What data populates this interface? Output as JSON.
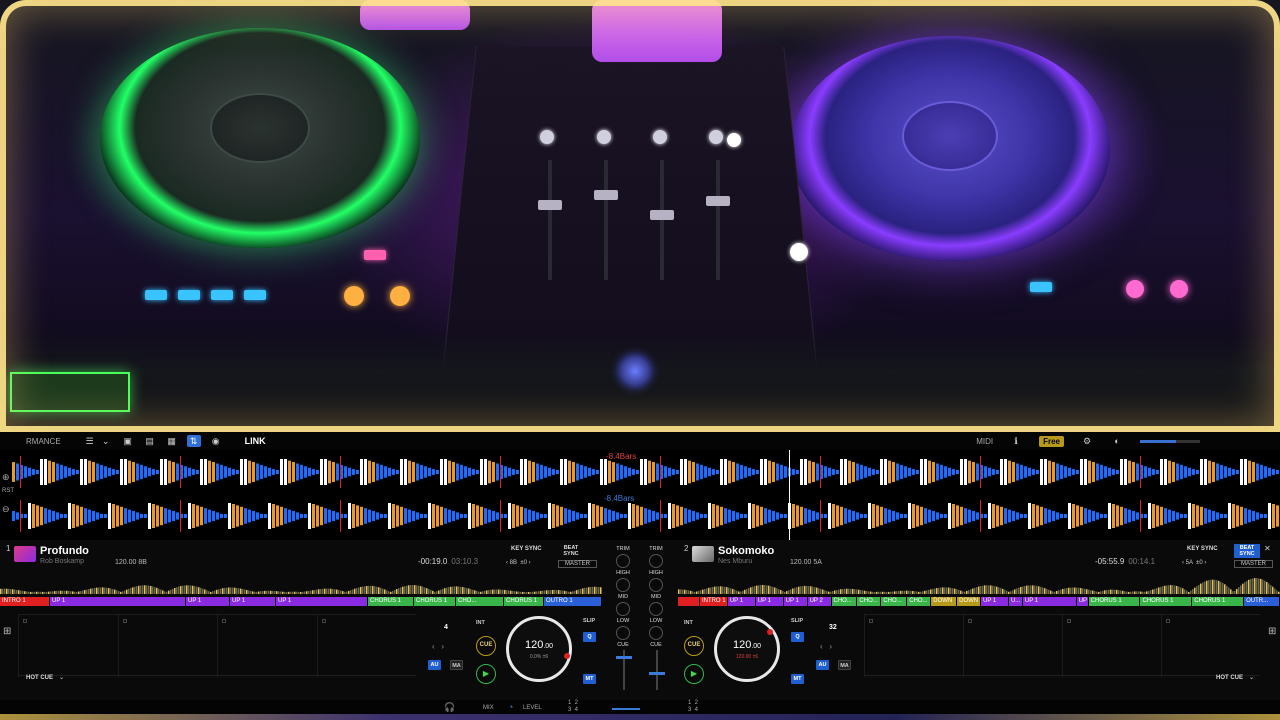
{
  "toolbar": {
    "mode_label": "RMANCE",
    "link_label": "LINK",
    "midi_label": "MIDI",
    "free_label": "Free",
    "icons": [
      "list-icon",
      "chevron-down-icon",
      "image-icon",
      "pin-icon",
      "grid-icon",
      "mixer-icon",
      "record-icon",
      "info-icon",
      "settings-icon",
      "volume-icon"
    ]
  },
  "waveforms": {
    "top_lag": "-8.4Bars",
    "bottom_lag": "-8.4Bars",
    "zoom_in_icon": "zoom-in-icon",
    "zoom_out_icon": "zoom-out-icon",
    "reset_label": "RST"
  },
  "deck_a": {
    "number": "1",
    "title": "Profundo",
    "artist": "Rob Boskamp",
    "bpm_key": "120.00 8B",
    "time_remaining": "-00:19.0",
    "time_total": "03:10.3",
    "key_sync_label": "KEY SYNC",
    "key_value": "8B",
    "key_offset": "±0",
    "beat_sync_label": "BEAT SYNC",
    "master_label": "MASTER",
    "structure": [
      {
        "label": "INTRO 1",
        "color": "#e02020",
        "w": 50
      },
      {
        "label": "UP 1",
        "color": "#8a2be2",
        "w": 136
      },
      {
        "label": "UP 1",
        "color": "#8a2be2",
        "w": 44
      },
      {
        "label": "UP 1",
        "color": "#8a2be2",
        "w": 46
      },
      {
        "label": "UP 1",
        "color": "#8a2be2",
        "w": 92
      },
      {
        "label": "CHORUS 1",
        "color": "#39b54a",
        "w": 46
      },
      {
        "label": "CHORUS 1",
        "color": "#39b54a",
        "w": 42
      },
      {
        "label": "CHO...",
        "color": "#39b54a",
        "w": 48
      },
      {
        "label": "CHORUS 1",
        "color": "#39b54a",
        "w": 40
      },
      {
        "label": "OUTRO 1",
        "color": "#2a5fd8",
        "w": 58
      }
    ],
    "beat_count": "4",
    "quantize_label": "INT",
    "cue_label": "CUE",
    "play_icon": "play-icon",
    "bpm": "120",
    "bpm_dec": ".00",
    "pitch": "0.0%  ±6",
    "slip_label": "SLIP",
    "q_label": "Q",
    "au_label": "AU",
    "ma_label": "MA",
    "mt_label": "MT",
    "hotcue_label": "HOT CUE"
  },
  "deck_b": {
    "number": "2",
    "title": "Sokomoko",
    "artist": "Nes Mburu",
    "bpm_key": "120.00 5A",
    "time_remaining": "-05:55.9",
    "time_total": "00:14.1",
    "key_sync_label": "KEY SYNC",
    "key_value": "5A",
    "key_offset": "±0",
    "beat_sync_label": "BEAT SYNC",
    "master_label": "MASTER",
    "structure": [
      {
        "label": "",
        "color": "#e02020",
        "w": 22
      },
      {
        "label": "INTRO 1",
        "color": "#e02020",
        "w": 28
      },
      {
        "label": "UP 1",
        "color": "#8a2be2",
        "w": 28
      },
      {
        "label": "UP 1",
        "color": "#8a2be2",
        "w": 28
      },
      {
        "label": "UP 1",
        "color": "#8a2be2",
        "w": 24
      },
      {
        "label": "UP 2",
        "color": "#8a2be2",
        "w": 24
      },
      {
        "label": "CHO...",
        "color": "#39b54a",
        "w": 26
      },
      {
        "label": "CHO...",
        "color": "#39b54a",
        "w": 24
      },
      {
        "label": "CHO...",
        "color": "#39b54a",
        "w": 26
      },
      {
        "label": "CHO...",
        "color": "#39b54a",
        "w": 24
      },
      {
        "label": "DOWN",
        "color": "#b89a1a",
        "w": 26
      },
      {
        "label": "DOWN",
        "color": "#b89a1a",
        "w": 24
      },
      {
        "label": "UP 1",
        "color": "#8a2be2",
        "w": 28
      },
      {
        "label": "U...",
        "color": "#8a2be2",
        "w": 14
      },
      {
        "label": "UP 1",
        "color": "#8a2be2",
        "w": 54
      },
      {
        "label": "UP 1",
        "color": "#8a2be2",
        "w": 12
      },
      {
        "label": "CHORUS 1",
        "color": "#39b54a",
        "w": 52
      },
      {
        "label": "CHORUS 1",
        "color": "#39b54a",
        "w": 52
      },
      {
        "label": "CHORUS 1",
        "color": "#39b54a",
        "w": 52
      },
      {
        "label": "OUTR...",
        "color": "#2a5fd8",
        "w": 36
      }
    ],
    "beat_count": "32",
    "quantize_label": "INT",
    "cue_label": "CUE",
    "play_icon": "play-icon",
    "bpm": "120",
    "bpm_dec": ".00",
    "pitch": "120.00  ±6",
    "slip_label": "SLIP",
    "q_label": "Q",
    "au_label": "AU",
    "ma_label": "MA",
    "mt_label": "MT",
    "hotcue_label": "HOT CUE"
  },
  "mixer": {
    "trim_label": "TRIM",
    "high_label": "HIGH",
    "mid_label": "MID",
    "low_label": "LOW",
    "cue_label": "CUE"
  },
  "bottom": {
    "mix_label": "MIX",
    "level_label": "LEVEL",
    "ch_a": "1  2\n3  4",
    "ch_b": "1  2\n3  4",
    "headphone_icon": "headphone-icon"
  },
  "colors": {
    "accent_blue": "#2f6fd6",
    "cue_gold": "#b89a1a",
    "play_green": "#38b54a",
    "wave_blue": "#1e6cff",
    "wave_orange": "#e89a30"
  }
}
